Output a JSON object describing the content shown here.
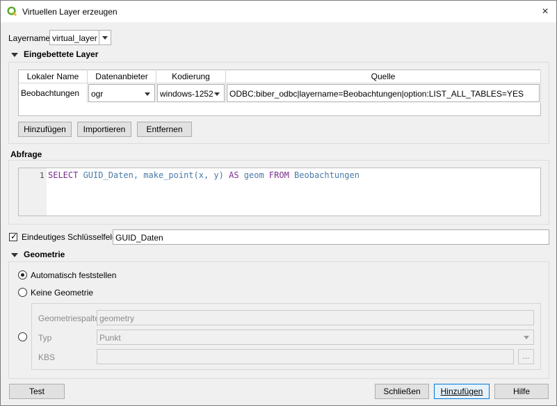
{
  "window": {
    "title": "Virtuellen Layer erzeugen",
    "close_icon": "×"
  },
  "layername": {
    "label": "Layername",
    "value": "virtual_layer"
  },
  "embedded": {
    "title": "Eingebettete Layer",
    "columns": [
      "Lokaler Name",
      "Datenanbieter",
      "Kodierung",
      "Quelle"
    ],
    "row": {
      "local_name": "Beobachtungen",
      "provider": "ogr",
      "encoding": "windows-1252",
      "source": "ODBC:biber_odbc|layername=Beobachtungen|option:LIST_ALL_TABLES=YES"
    },
    "buttons": {
      "add": "Hinzufügen",
      "import": "Importieren",
      "remove": "Entfernen"
    }
  },
  "query": {
    "title": "Abfrage",
    "line_number": "1",
    "tokens": {
      "select": "SELECT",
      "fields": " GUID_Daten, make_point(x, y) ",
      "as": "AS",
      "alias": " geom ",
      "from": "FROM",
      "table": " Beobachtungen"
    }
  },
  "unique_key": {
    "label": "Eindeutiges Schlüsselfeld",
    "checked": true,
    "value": "GUID_Daten"
  },
  "geometry": {
    "title": "Geometrie",
    "auto_detect": "Automatisch feststellen",
    "no_geometry": "Keine Geometrie",
    "column_label": "Geometriespalte",
    "column_value": "geometry",
    "type_label": "Typ",
    "type_value": "Punkt",
    "crs_label": "KBS",
    "crs_button": "..."
  },
  "footer": {
    "test": "Test",
    "close": "Schließen",
    "add": "Hinzufügen",
    "help": "Hilfe"
  }
}
